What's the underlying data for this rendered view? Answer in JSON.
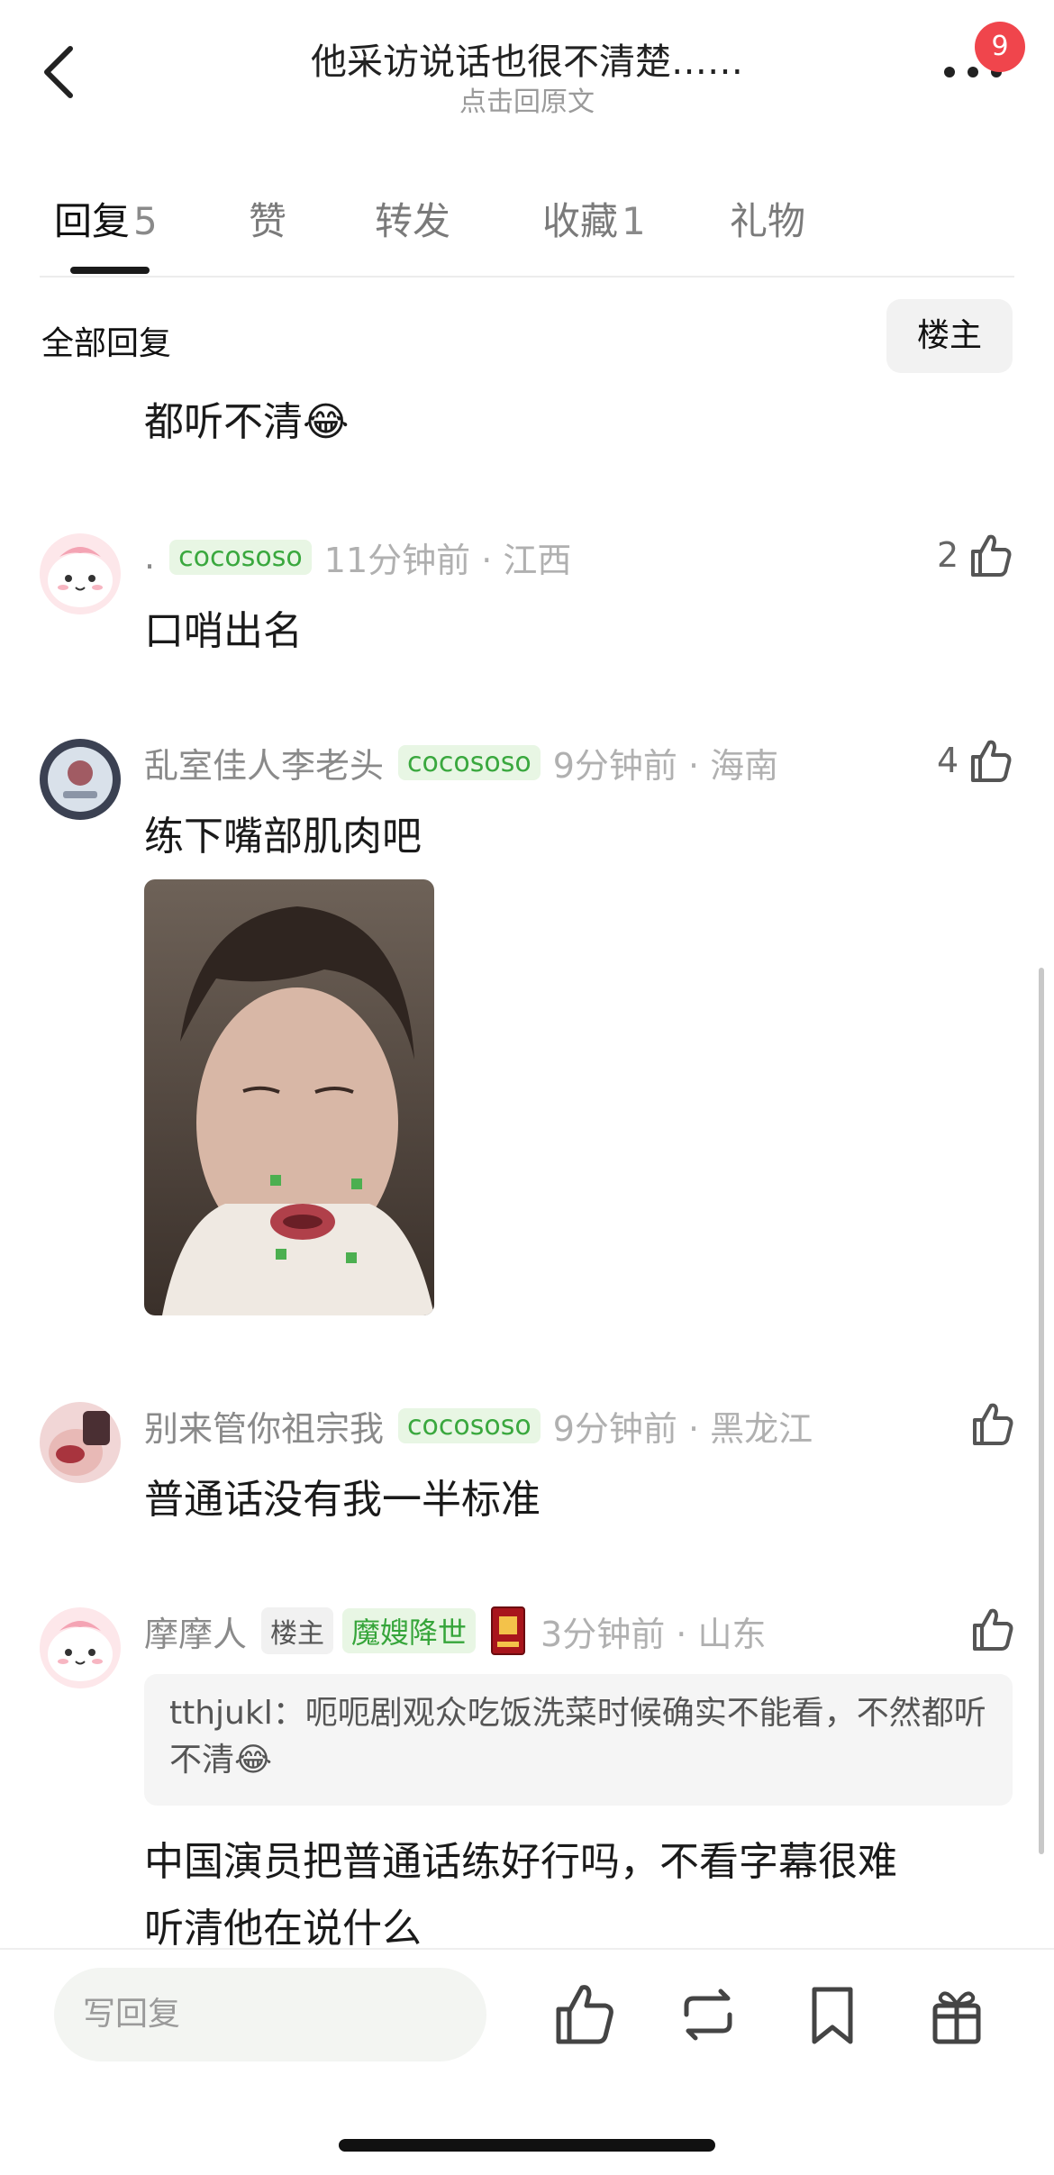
{
  "header": {
    "title": "他采访说话也很不清楚……",
    "subtitle": "点击回原文",
    "badge_count": "9"
  },
  "tabs": [
    {
      "label": "回复",
      "count": "5"
    },
    {
      "label": "赞"
    },
    {
      "label": "转发"
    },
    {
      "label": "收藏",
      "count": "1"
    },
    {
      "label": "礼物"
    }
  ],
  "section": {
    "all_replies": "全部回复",
    "owner_filter": "楼主"
  },
  "comments": [
    {
      "text": "都听不清😂"
    },
    {
      "username": ".",
      "tag": "cocososo",
      "time": "11分钟前 · 江西",
      "likes": "2",
      "text": "口哨出名"
    },
    {
      "username": "乱室佳人李老头",
      "tag": "cocososo",
      "time": "9分钟前 · 海南",
      "likes": "4",
      "text": "练下嘴部肌肉吧"
    },
    {
      "username": "别来管你祖宗我",
      "tag": "cocososo",
      "time": "9分钟前 · 黑龙江",
      "text": "普通话没有我一半标准"
    },
    {
      "username": "摩摩人",
      "owner_tag": "楼主",
      "tag": "魔嫂降世",
      "time": "3分钟前 · 山东",
      "quote": "tthjukl：呃呃剧观众吃饭洗菜时候确实不能看，不然都听不清😂",
      "text_line1": "中国演员把普通话练好行吗，不看字幕很难",
      "text_line2": "听清他在说什么"
    }
  ],
  "bottom_bar": {
    "reply_placeholder": "写回复"
  }
}
